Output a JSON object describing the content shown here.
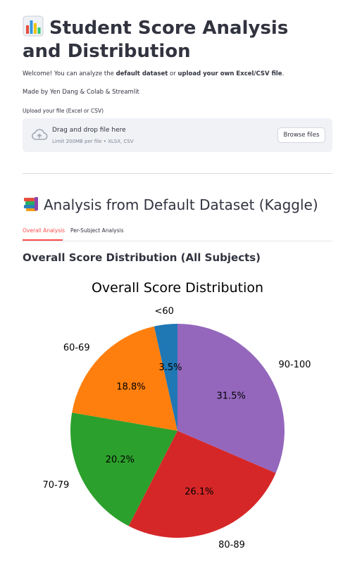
{
  "header": {
    "title_icon": "bar-chart-icon",
    "title": "Student Score Analysis and Distribution",
    "welcome_prefix": "Welcome! You can analyze the ",
    "welcome_bold1": "default dataset",
    "welcome_mid": " or ",
    "welcome_bold2": "upload your own Excel/CSV file",
    "welcome_suffix": ".",
    "credits": "Made by Yen Dang & Colab & Streamlit"
  },
  "uploader": {
    "label": "Upload your file (Excel or CSV)",
    "drag_text": "Drag and drop file here",
    "limit_text": "Limit 200MB per file • XLSX, CSV",
    "browse_label": "Browse files",
    "icon": "cloud-upload-icon"
  },
  "section": {
    "icon": "books-icon",
    "title": "Analysis from Default Dataset (Kaggle)"
  },
  "tabs": [
    {
      "label": "Overall Analysis",
      "active": true
    },
    {
      "label": "Per-Subject Analysis",
      "active": false
    }
  ],
  "subheader": "Overall Score Distribution (All Subjects)",
  "chart_data": {
    "type": "pie",
    "title": "Overall Score Distribution",
    "start_angle_deg": 90,
    "direction": "clockwise",
    "slices": [
      {
        "label": "90-100",
        "value": 31.5,
        "pct_label": "31.5%",
        "color": "#9467bd"
      },
      {
        "label": "80-89",
        "value": 26.1,
        "pct_label": "26.1%",
        "color": "#d62728"
      },
      {
        "label": "70-79",
        "value": 20.2,
        "pct_label": "20.2%",
        "color": "#2ca02c"
      },
      {
        "label": "60-69",
        "value": 18.8,
        "pct_label": "18.8%",
        "color": "#ff7f0e"
      },
      {
        "label": "<60",
        "value": 3.5,
        "pct_label": "3.5%",
        "color": "#1f77b4"
      }
    ]
  },
  "colors": {
    "accent": "#ff4b4b",
    "text": "#31333f",
    "muted": "#808495",
    "uploader_bg": "#f0f2f6"
  }
}
